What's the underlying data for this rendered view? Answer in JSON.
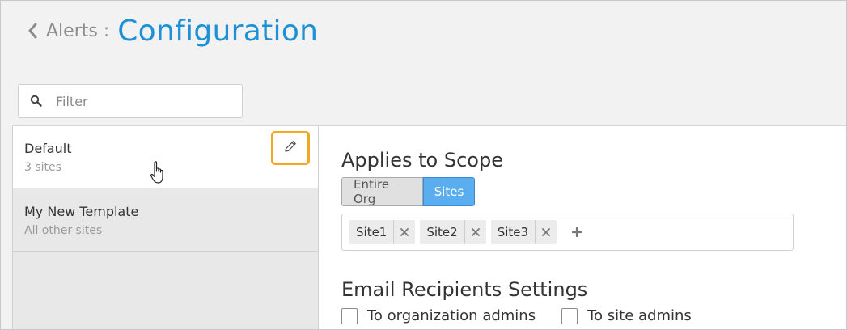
{
  "header": {
    "back_icon": "chevron-left-icon",
    "breadcrumb": "Alerts :",
    "title": "Configuration"
  },
  "filter": {
    "placeholder": "Filter",
    "icon": "search-icon"
  },
  "templates": [
    {
      "name": "Default",
      "sub": "3 sites",
      "selected": true
    },
    {
      "name": "My New Template",
      "sub": "All other sites",
      "selected": false
    }
  ],
  "scope": {
    "title": "Applies to Scope",
    "options": [
      "Entire Org",
      "Sites"
    ],
    "selected": "Sites",
    "tags": [
      "Site1",
      "Site2",
      "Site3"
    ]
  },
  "email": {
    "title": "Email Recipients Settings",
    "options": [
      "To organization admins",
      "To site admins"
    ]
  },
  "colors": {
    "accent": "#1e90d6",
    "highlight": "#f5a623",
    "segment_active": "#5aaef0"
  }
}
